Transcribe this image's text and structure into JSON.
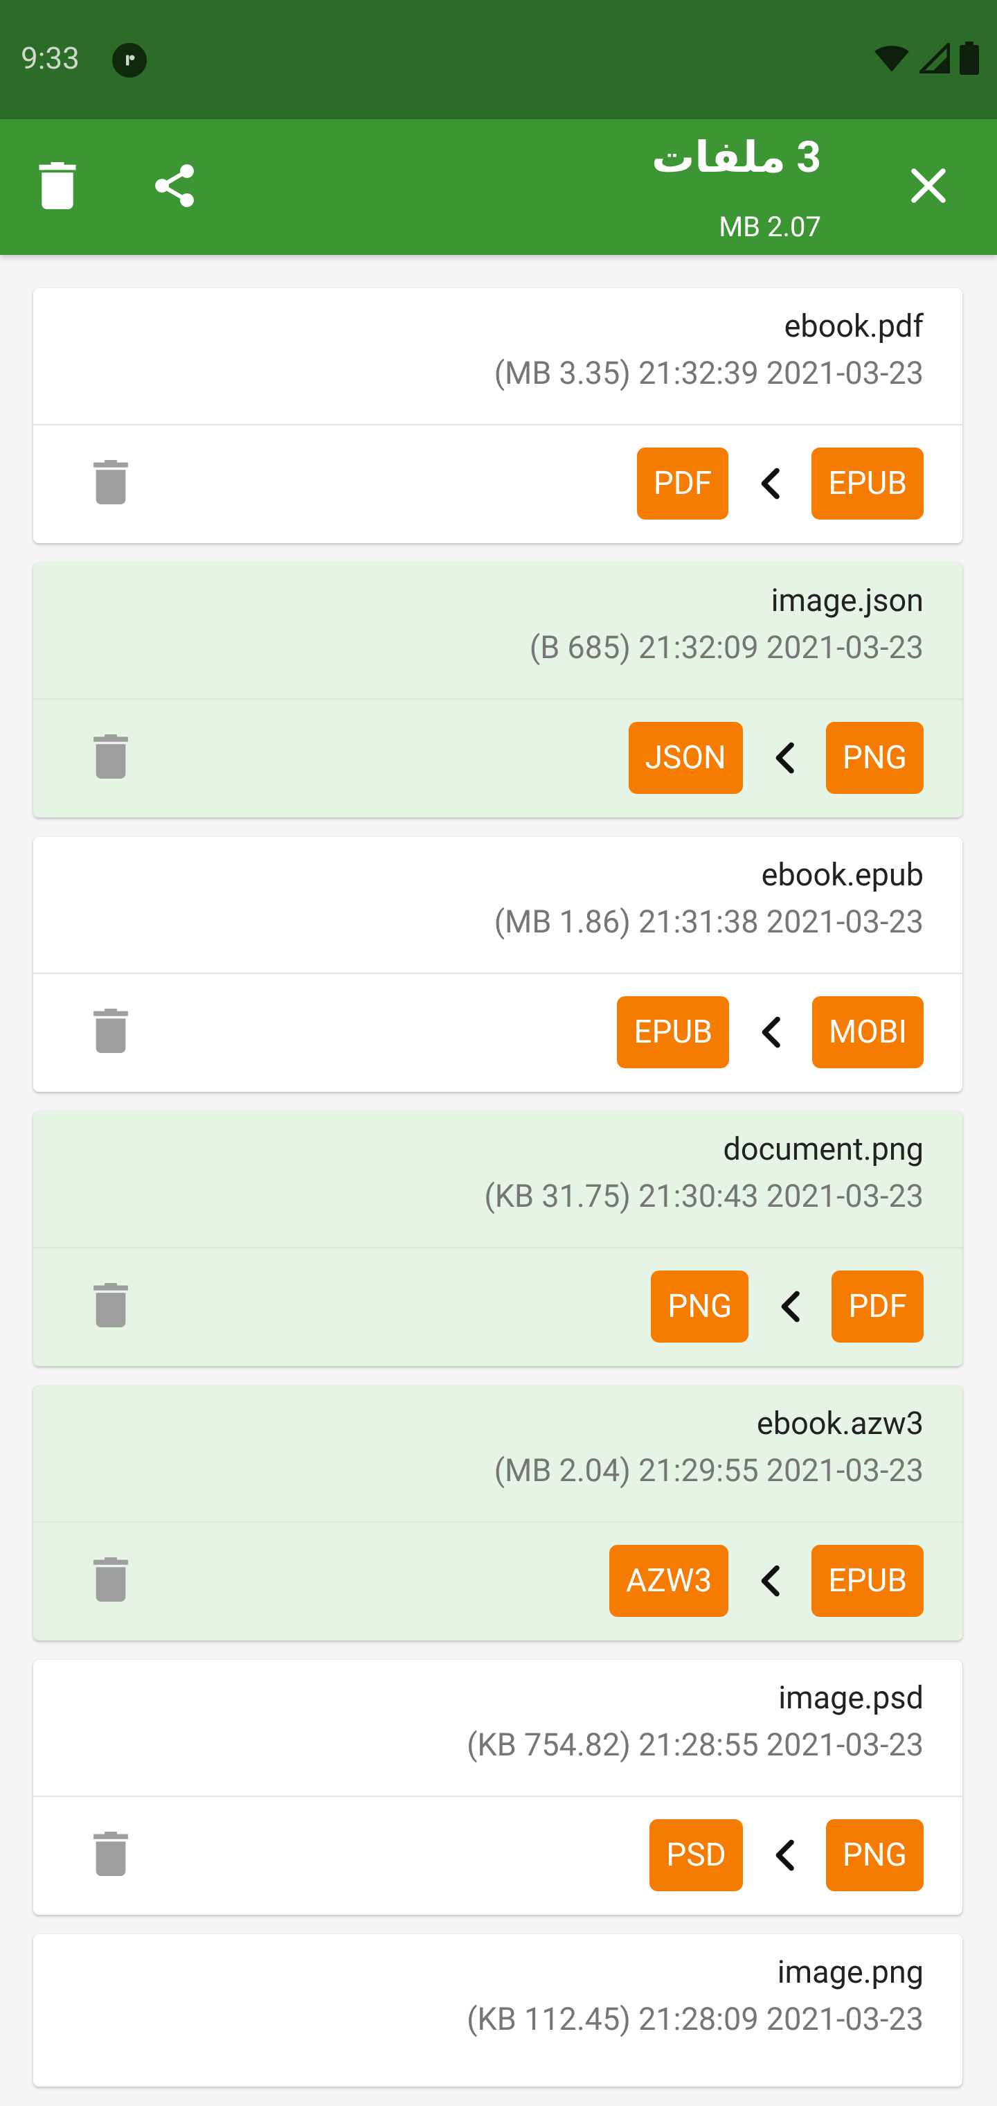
{
  "status_bar": {
    "time": "9:33",
    "icons": [
      "app-notification-icon",
      "wifi-icon",
      "signal-icon",
      "battery-icon"
    ]
  },
  "app_bar": {
    "title": "3 ملفات",
    "subtitle": "MB 2.07",
    "actions": [
      "delete-icon",
      "share-icon",
      "close-icon"
    ]
  },
  "colors": {
    "status_bar": "#2c6b28",
    "app_bar": "#3d9634",
    "badge": "#f57c00",
    "selected_card": "#e6f4e6"
  },
  "files": [
    {
      "name": "ebook.pdf",
      "meta": "(MB 3.35) 21:32:39 2021-03-23",
      "from": "EPUB",
      "to": "PDF",
      "selected": false
    },
    {
      "name": "image.json",
      "meta": "(B 685) 21:32:09 2021-03-23",
      "from": "PNG",
      "to": "JSON",
      "selected": true
    },
    {
      "name": "ebook.epub",
      "meta": "(MB 1.86) 21:31:38 2021-03-23",
      "from": "MOBI",
      "to": "EPUB",
      "selected": false
    },
    {
      "name": "document.png",
      "meta": "(KB 31.75) 21:30:43 2021-03-23",
      "from": "PDF",
      "to": "PNG",
      "selected": true
    },
    {
      "name": "ebook.azw3",
      "meta": "(MB 2.04) 21:29:55 2021-03-23",
      "from": "EPUB",
      "to": "AZW3",
      "selected": true
    },
    {
      "name": "image.psd",
      "meta": "(KB 754.82) 21:28:55 2021-03-23",
      "from": "PNG",
      "to": "PSD",
      "selected": false
    },
    {
      "name": "image.png",
      "meta": "(KB 112.45) 21:28:09 2021-03-23",
      "from": "",
      "to": "",
      "selected": false
    }
  ]
}
